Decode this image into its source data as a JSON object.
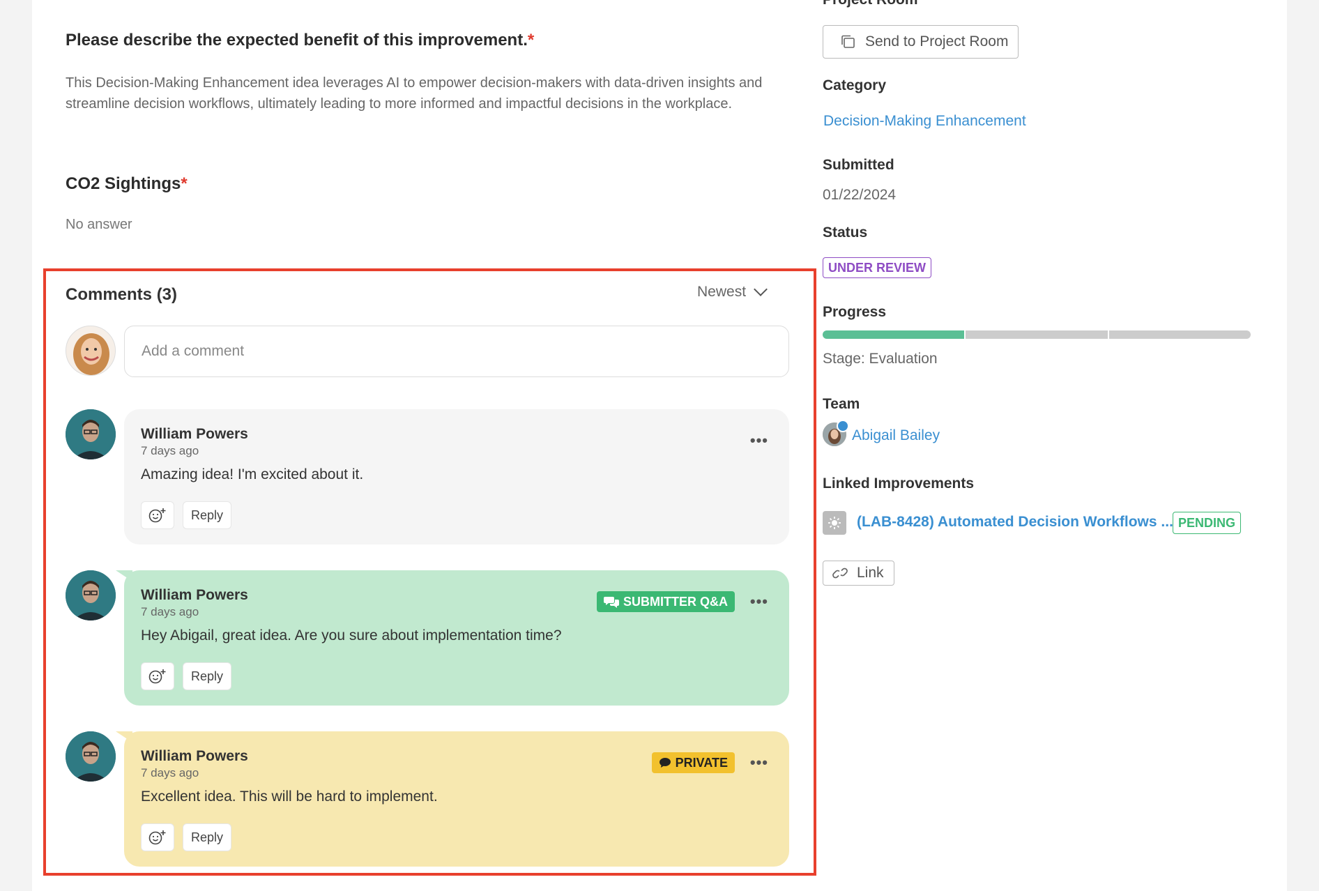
{
  "form": {
    "benefit_question": "Please describe the expected benefit of this improvement.",
    "required_mark": "*",
    "benefit_answer": "This Decision-Making Enhancement idea leverages AI to empower decision-makers with data-driven insights and streamline decision workflows, ultimately leading to more informed and impactful decisions in the workplace.",
    "co2_question": "CO2 Sightings",
    "co2_answer": "No answer"
  },
  "comments": {
    "title": "Comments (3)",
    "sort_label": "Newest",
    "add_placeholder": "Add a comment",
    "reply_label": "Reply",
    "items": [
      {
        "author": "William Powers",
        "time": "7 days ago",
        "text": "Amazing idea! I'm excited about it.",
        "badge": ""
      },
      {
        "author": "William Powers",
        "time": "7 days ago",
        "text": "Hey Abigail, great idea. Are you sure about implementation time?",
        "badge": "SUBMITTER Q&A"
      },
      {
        "author": "William Powers",
        "time": "7 days ago",
        "text": "Excellent idea. This will be hard to implement.",
        "badge": "PRIVATE"
      }
    ]
  },
  "sidebar": {
    "project_room_label": "Project Room",
    "send_button": "Send to Project Room",
    "category_label": "Category",
    "category_value": "Decision-Making Enhancement",
    "submitted_label": "Submitted",
    "submitted_value": "01/22/2024",
    "status_label": "Status",
    "status_value": "UNDER REVIEW",
    "progress_label": "Progress",
    "progress_stages_completed": 1,
    "progress_stages_total": 3,
    "stage_text": "Stage: Evaluation",
    "team_label": "Team",
    "team_member": "Abigail Bailey",
    "linked_label": "Linked Improvements",
    "linked_title": "(LAB-8428) Automated Decision Workflows ...",
    "linked_status": "PENDING",
    "link_button": "Link"
  },
  "colors": {
    "accent_link": "#3a8fd1",
    "required": "#e03a2e",
    "highlight_border": "#e8402d",
    "qa_bg": "#c1e9cf",
    "private_bg": "#f7e8b0",
    "status_purple": "#8e4cc4",
    "pending_green": "#3bb873"
  }
}
